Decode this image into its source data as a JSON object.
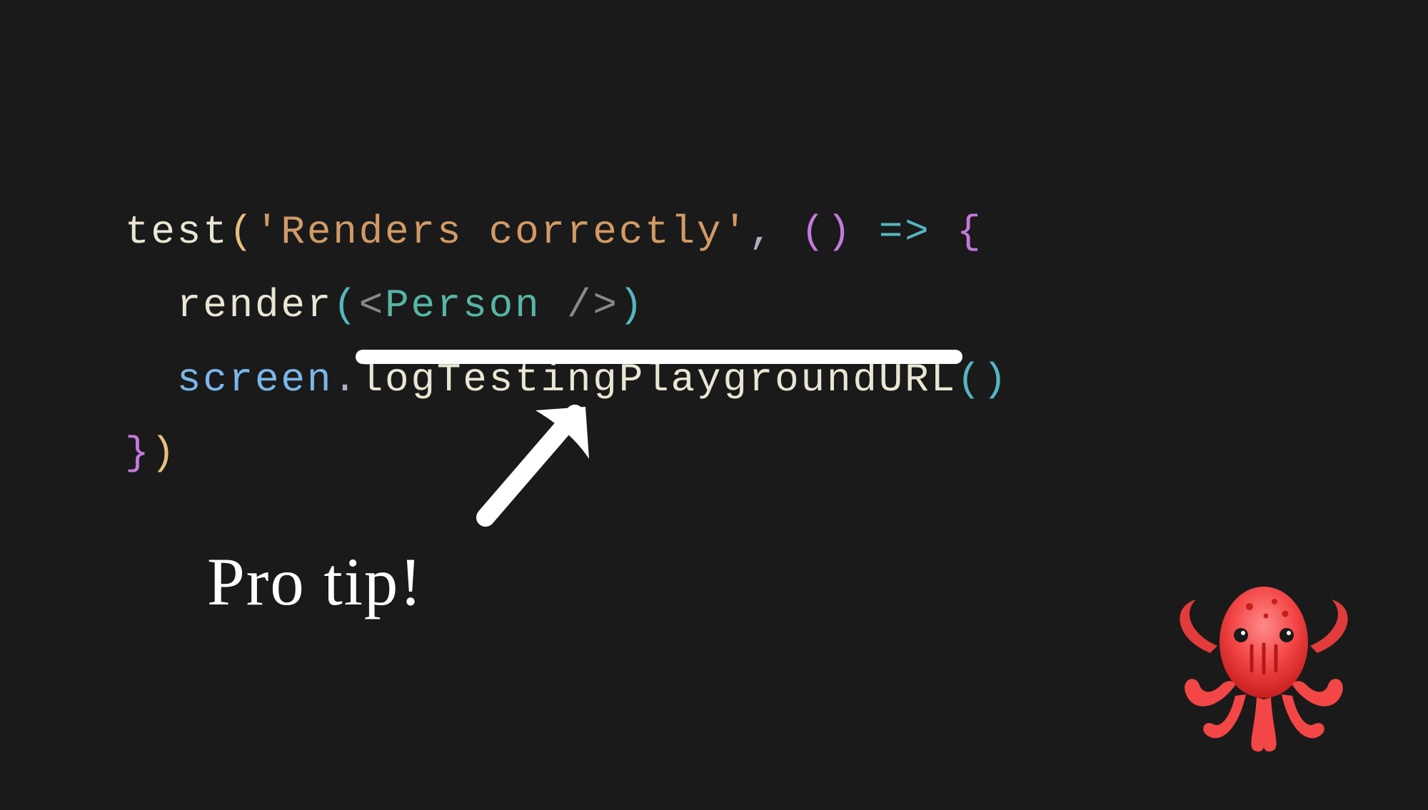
{
  "code": {
    "line1": {
      "fn": "test",
      "open": "(",
      "str": "'Renders correctly'",
      "comma": ",",
      "sp1": " ",
      "argopen": "(",
      "argclose": ")",
      "arrow": " => ",
      "brace": "{"
    },
    "line2": {
      "indent": "  ",
      "fn": "render",
      "open": "(",
      "lt": "<",
      "jsx": "Person",
      "sp": " ",
      "slash": "/",
      "gt": ">",
      "close": ")"
    },
    "line3": {
      "indent": "  ",
      "obj": "screen",
      "dot": ".",
      "method": "logTestingPlaygroundURL",
      "open": "(",
      "close": ")"
    },
    "line4": {
      "brace": "}",
      "close": ")"
    }
  },
  "annotation": {
    "protip": "Pro tip!"
  },
  "colors": {
    "bg": "#1a1a1a",
    "white": "#ffffff",
    "yellow": "#e5c07b",
    "purple": "#c678dd",
    "cyan": "#56b6c2",
    "orange": "#d19a66",
    "grey": "#abb2bf",
    "teal": "#56b6a6",
    "blue": "#7ab7e8",
    "cream": "#eae6d4",
    "octopus_body": "#f34646",
    "octopus_light": "#ff7a7a"
  }
}
